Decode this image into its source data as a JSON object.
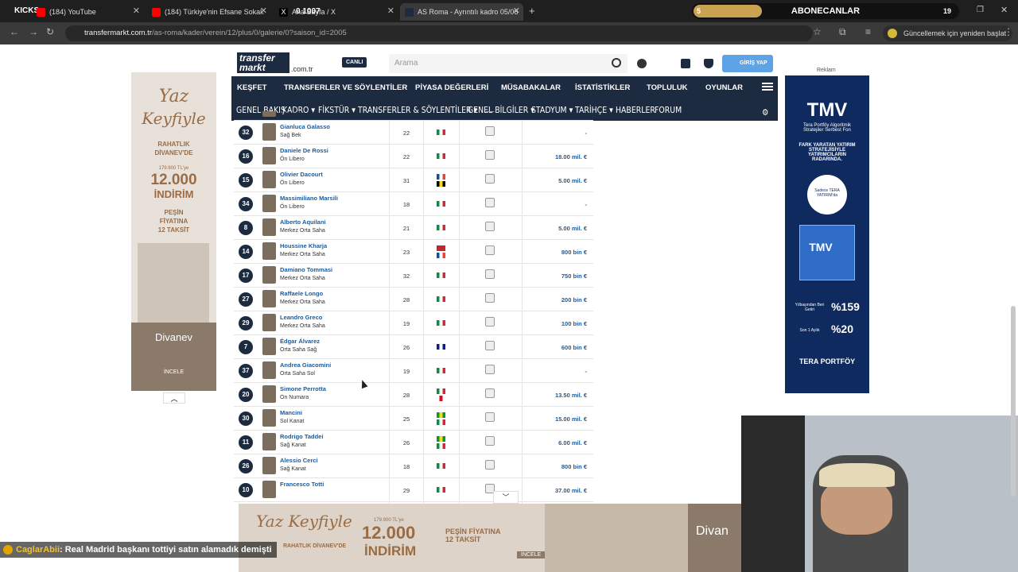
{
  "browser": {
    "tabs": [
      {
        "label": "(184) YouTube",
        "favicon_color": "#ff0000"
      },
      {
        "label": "(184) Türkiye'nin Efsane Sokak",
        "favicon_color": "#ff0000"
      },
      {
        "label": "Ana Sayfa / X",
        "favicon_color": "#ffffff"
      },
      {
        "label": "AS Roma - Ayrıntılı kadro 05/06",
        "favicon_color": "#1d2b40"
      }
    ],
    "url_host": "transfermarkt.com.tr",
    "url_path": "/as-roma/kader/verein/12/plus/0/galerie/0?saison_id=2005",
    "update_button": "Güncellemek için yeniden başlat"
  },
  "overlay": {
    "kicks_label": "KICKS",
    "timer": "0 1007",
    "aboneler_title": "ABONECANLAR",
    "aboneler_left": "5",
    "aboneler_right": "19",
    "chat_user": "CaglarAbii",
    "chat_message": ": Real Madrid başkanı tottiyi satın alamadık demişti"
  },
  "site": {
    "logo_text": "transfer markt",
    "logo_tld": ".com.tr",
    "live_badge": "CANLI",
    "search_placeholder": "Arama",
    "login_label": "GİRİŞ YAP",
    "main_nav": [
      "KEŞFET",
      "TRANSFERLER VE SÖYLENTİLER",
      "PİYASA DEĞERLERİ",
      "MÜSABAKALAR",
      "İSTATİSTİKLER",
      "TOPLULUK",
      "OYUNLAR"
    ],
    "sub_nav": [
      "GENEL BAKIŞ",
      "KADRO ▾",
      "FİKSTÜR ▾",
      "TRANSFERLER & SÖYLENTİLER ▾",
      "GENEL BİLGİLER ▾",
      "STADYUM ▾",
      "TARİHÇE ▾",
      "HABERLER",
      "FORUM"
    ]
  },
  "squad": [
    {
      "num": "",
      "name": "",
      "pos": "Sağ Bek",
      "age": "",
      "value": ""
    },
    {
      "num": "32",
      "name": "Gianluca Galasso",
      "pos": "Sağ Bek",
      "age": "22",
      "value": "-"
    },
    {
      "num": "16",
      "name": "Daniele De Rossi",
      "pos": "Ön Libero",
      "age": "22",
      "value": "18.00 mil. €"
    },
    {
      "num": "15",
      "name": "Olivier Dacourt",
      "pos": "Ön Libero",
      "age": "31",
      "value": "5.00 mil. €"
    },
    {
      "num": "34",
      "name": "Massimiliano Marsili",
      "pos": "Ön Libero",
      "age": "18",
      "value": "-"
    },
    {
      "num": "8",
      "name": "Alberto Aquilani",
      "pos": "Merkez Orta Saha",
      "age": "21",
      "value": "5.00 mil. €"
    },
    {
      "num": "14",
      "name": "Houssine Kharja",
      "pos": "Merkez Orta Saha",
      "age": "23",
      "value": "800 bin €"
    },
    {
      "num": "17",
      "name": "Damiano Tommasi",
      "pos": "Merkez Orta Saha",
      "age": "32",
      "value": "750 bin €"
    },
    {
      "num": "27",
      "name": "Raffaele Longo",
      "pos": "Merkez Orta Saha",
      "age": "28",
      "value": "200 bin €"
    },
    {
      "num": "29",
      "name": "Leandro Greco",
      "pos": "Merkez Orta Saha",
      "age": "19",
      "value": "100 bin €"
    },
    {
      "num": "7",
      "name": "Édgar Álvarez",
      "pos": "Orta Saha Sağ",
      "age": "26",
      "value": "600 bin €"
    },
    {
      "num": "37",
      "name": "Andrea Giacomini",
      "pos": "Orta Saha Sol",
      "age": "19",
      "value": "-"
    },
    {
      "num": "20",
      "name": "Simone Perrotta",
      "pos": "On Numara",
      "age": "28",
      "value": "13.50 mil. €"
    },
    {
      "num": "30",
      "name": "Mancini",
      "pos": "Sol Kanat",
      "age": "25",
      "value": "15.00 mil. €"
    },
    {
      "num": "11",
      "name": "Rodrigo Taddei",
      "pos": "Sağ Kanat",
      "age": "26",
      "value": "6.00 mil. €"
    },
    {
      "num": "26",
      "name": "Alessio Cerci",
      "pos": "Sağ Kanat",
      "age": "18",
      "value": "800 bin €"
    },
    {
      "num": "10",
      "name": "Francesco Totti",
      "pos": "",
      "age": "29",
      "value": "37.00 mil. €"
    }
  ],
  "ads": {
    "left_lines": [
      "Yaz",
      "Keyfiyle",
      "RAHATLIK",
      "DİVANEV'DE",
      "179.900 TL'ye",
      "12.000",
      "İNDİRİM",
      "PEŞİN",
      "FİYATINA",
      "12 TAKSİT",
      "Divanev",
      "İNCELE"
    ],
    "right_label": "Reklam",
    "right_lines": [
      "TMV",
      "Tera Portföy Algoritmik Stratejiler Serbest Fon",
      "FARK YARATAN YATIRIM STRATEJİSİYLE YATIRIMCILARIN RADARINDA.",
      "Sadece TERA YATIRIM'da",
      "TMV",
      "Yılbaşından Beri Getiri",
      "%159",
      "Son 1 Aylık",
      "%20",
      "TERA PORTFÖY"
    ],
    "bottom_lines": [
      "Yaz Keyfiyle",
      "RAHATLIK DİVANEV'DE",
      "179.900 TL'ye",
      "12.000",
      "İNDİRİM",
      "PEŞİN FİYATINA 12 TAKSİT",
      "İNCELE",
      "Divan"
    ]
  }
}
